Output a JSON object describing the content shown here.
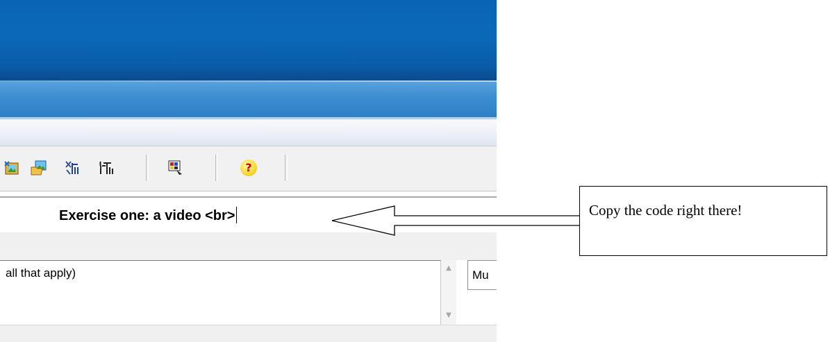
{
  "editor": {
    "title_field_value": "Exercise one: a video <br>",
    "choices_text": " all that apply)",
    "question_type_value": "Mu"
  },
  "toolbar": {
    "icons": [
      "insert-image-icon",
      "open-image-icon",
      "fx-icon",
      "fx2-icon",
      "colors-icon",
      "help-icon"
    ],
    "help_glyph": "?"
  },
  "scrollbar": {
    "up_glyph": "▲",
    "down_glyph": "▼"
  },
  "callout": {
    "text": "Copy the code right there!"
  },
  "colors": {
    "title_bar": "#0a64b6",
    "task_strip": "#3c8ed1",
    "toolbar_bg": "#f1f1f1"
  }
}
